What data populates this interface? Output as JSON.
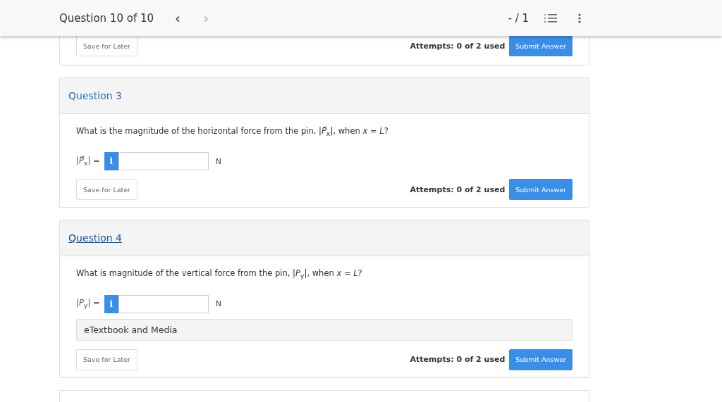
{
  "header": {
    "title": "Question 10 of 10",
    "prev": "‹",
    "next": "›",
    "score": "- / 1"
  },
  "top_card": {
    "save": "Save for Later",
    "attempts": "Attempts: 0 of 2 used",
    "submit": "Submit Answer"
  },
  "questions": [
    {
      "title": "Question 3",
      "hovered": false,
      "prompt": "What is the magnitude of the horizontal force from the pin, |*P⃗*$_{x}$|, when *x* = *L*?",
      "input_label": "|*P⃗*$_{x}$| =",
      "info": "i",
      "unit": "N",
      "save": "Save for Later",
      "attempts": "Attempts: 0 of 2 used",
      "submit": "Submit Answer"
    },
    {
      "title": "Question 4",
      "hovered": true,
      "prompt": "What is magnitude of the vertical force from the pin, |*P*$_{y}$|, when *x* = *L*?",
      "input_label": "|*P*$_{y}$| =",
      "info": "i",
      "unit": "N",
      "resources": "eTextbook and Media",
      "save": "Save for Later",
      "attempts": "Attempts: 0 of 2 used",
      "submit": "Submit Answer"
    }
  ]
}
